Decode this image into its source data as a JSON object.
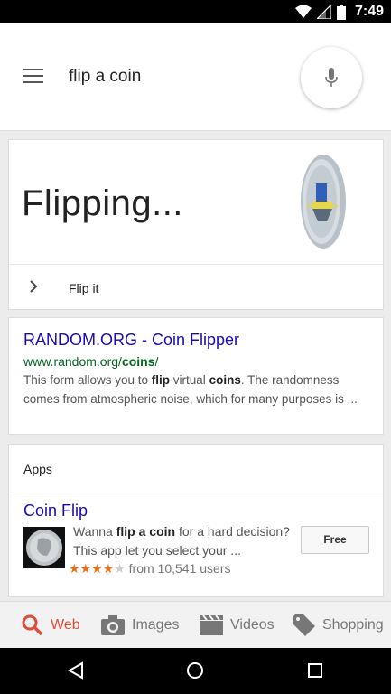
{
  "status_bar": {
    "time": "7:49"
  },
  "search": {
    "query": "flip a coin"
  },
  "coin_card": {
    "status": "Flipping...",
    "action_label": "Flip it"
  },
  "result": {
    "title": "RANDOM.ORG - Coin Flipper",
    "url_prefix": "www.random.org/",
    "url_bold": "coins",
    "url_suffix": "/",
    "snippet_1": "This form allows you to ",
    "snippet_b1": "flip",
    "snippet_2": " virtual ",
    "snippet_b2": "coins",
    "snippet_3": ". The randomness comes from atmospheric noise, which for many purposes is ..."
  },
  "apps": {
    "header": "Apps",
    "app_title": "Coin Flip",
    "desc_1": "Wanna ",
    "desc_b": "flip a coin",
    "desc_2": " for a hard decision?",
    "desc_3": "This app let you select your ...",
    "rating": 4,
    "stars_filled": "★★★★",
    "stars_empty": "★",
    "rating_text": "from 10,541 users",
    "price_label": "Free"
  },
  "tabs": [
    {
      "label": "Web",
      "icon": "search-icon",
      "active": true
    },
    {
      "label": "Images",
      "icon": "camera-icon",
      "active": false
    },
    {
      "label": "Videos",
      "icon": "clapperboard-icon",
      "active": false
    },
    {
      "label": "Shopping",
      "icon": "tag-icon",
      "active": false
    }
  ],
  "colors": {
    "link": "#1a0dab",
    "url": "#006621",
    "active_tab": "#dd4b39",
    "star": "#e7711b"
  }
}
